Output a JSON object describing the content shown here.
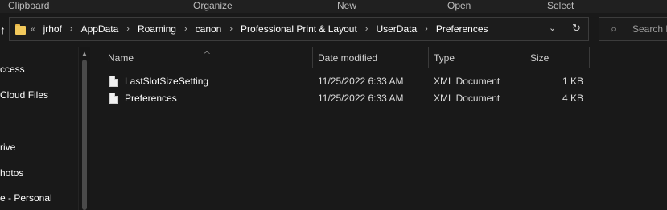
{
  "ribbon": {
    "groups": [
      "Clipboard",
      "Organize",
      "New",
      "Open",
      "Select"
    ]
  },
  "address_bar": {
    "lead": "«",
    "crumbs": [
      "jrhof",
      "AppData",
      "Roaming",
      "canon",
      "Professional Print & Layout",
      "UserData",
      "Preferences"
    ],
    "separator": "›"
  },
  "search": {
    "placeholder": "Search Pr"
  },
  "nav": {
    "items": [
      "ccess",
      "Cloud Files",
      "rive",
      "hotos",
      "e - Personal"
    ]
  },
  "columns": {
    "name": "Name",
    "date": "Date modified",
    "type": "Type",
    "size": "Size"
  },
  "files": [
    {
      "name": "LastSlotSizeSetting",
      "date": "11/25/2022 6:33 AM",
      "type": "XML Document",
      "size": "1 KB"
    },
    {
      "name": "Preferences",
      "date": "11/25/2022 6:33 AM",
      "type": "XML Document",
      "size": "4 KB"
    }
  ],
  "icons": {
    "folder": "folder-icon",
    "file": "file-icon",
    "search": "search-icon",
    "refresh": "refresh-icon",
    "chevron": "chevron-down-icon",
    "up": "up-arrow-icon",
    "sort": "sort-up-icon"
  },
  "colors": {
    "background": "#191919",
    "folder": "#f1c85b",
    "text": "#ffffff"
  }
}
